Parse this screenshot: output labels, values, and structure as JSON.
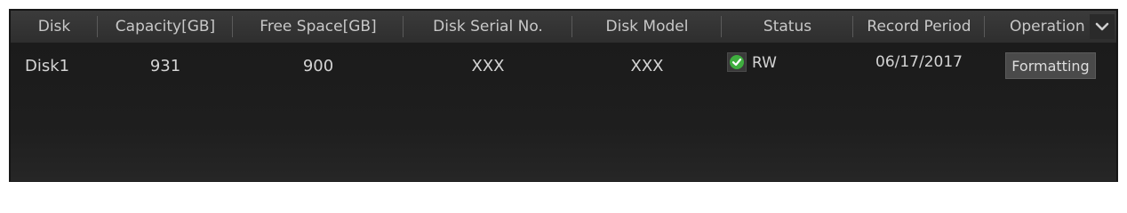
{
  "table": {
    "columns": [
      "Disk",
      "Capacity[GB]",
      "Free Space[GB]",
      "Disk Serial No.",
      "Disk Model",
      "Status",
      "Record Period",
      "Operation"
    ],
    "rows": [
      {
        "disk": "Disk1",
        "capacity": "931",
        "free_space": "900",
        "serial": "XXX",
        "model": "XXX",
        "status": "RW",
        "record_period": "06/17/2017",
        "operation": "Formatting"
      }
    ]
  },
  "icons": {
    "status": "check-icon",
    "header_dropdown": "chevron-down-icon"
  },
  "colors": {
    "background": "#141414",
    "header": "#363636",
    "check_green": "#3fae3f",
    "text": "#d4d4d4"
  }
}
